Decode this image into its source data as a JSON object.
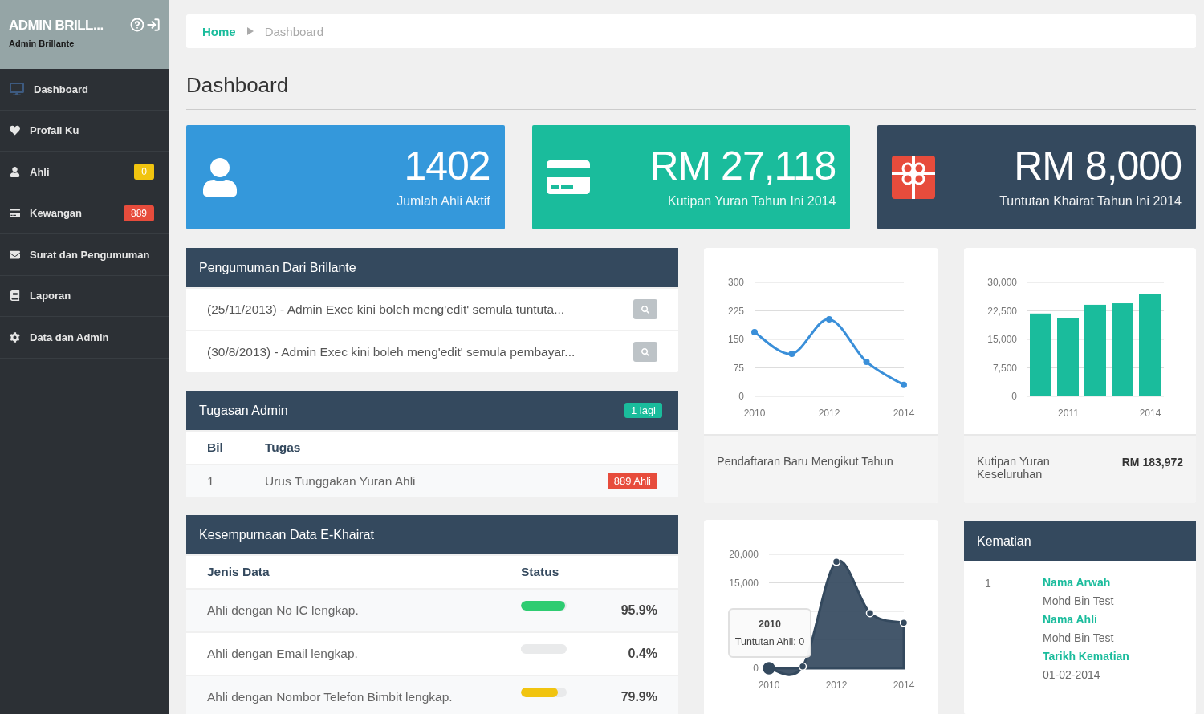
{
  "sidebar": {
    "title": "ADMIN BRILL...",
    "user": "Admin Brillante",
    "items": [
      {
        "label": "Dashboard",
        "selected": false
      },
      {
        "label": "Profail Ku",
        "selected": false
      },
      {
        "label": "Ahli",
        "selected": false,
        "badge": "0",
        "color": "#f1c40f"
      },
      {
        "label": "Kewangan",
        "selected": false,
        "badge": "889",
        "color": "#e74c3c"
      },
      {
        "label": "Surat dan Pengumuman",
        "selected": false
      },
      {
        "label": "Laporan",
        "selected": false
      },
      {
        "label": "Data dan Admin",
        "selected": false
      }
    ]
  },
  "breadcrumb": [
    {
      "label": "Home",
      "current": false
    },
    {
      "label": "Dashboard",
      "current": true
    }
  ],
  "page_title": "Dashboard",
  "stats": [
    {
      "value": "1402",
      "label": "Jumlah Ahli Aktif",
      "color": "#3498db"
    },
    {
      "value": "RM 27,118",
      "label": "Kutipan Yuran Tahun Ini 2014",
      "color": "#1abc9c"
    },
    {
      "value": "RM 8,000",
      "label": "Tuntutan Khairat Tahun Ini 2014",
      "color": "#34495e"
    }
  ],
  "announcements": {
    "title": "Pengumuman Dari Brillante",
    "items": [
      "(25/11/2013) - Admin Exec kini boleh meng'edit' semula tuntuta...",
      "(30/8/2013) - Admin Exec kini boleh meng'edit' semula pembayar..."
    ]
  },
  "tasks": {
    "title": "Tugasan Admin",
    "badge": "1 lagi",
    "columns": [
      "Bil",
      "Tugas"
    ],
    "rows": [
      {
        "no": "1",
        "task": "Urus Tunggakan Yuran Ahli",
        "badge": "889 Ahli"
      }
    ]
  },
  "completeness": {
    "title": "Kesempurnaan Data E-Khairat",
    "columns": [
      "Jenis Data",
      "Status"
    ],
    "rows": [
      {
        "label": "Ahli dengan No IC lengkap.",
        "level": 0.959,
        "value": "95.9%",
        "color": "#2ecc71"
      },
      {
        "label": "Ahli dengan Email lengkap.",
        "level": 0.004,
        "value": "0.4%"
      },
      {
        "label": "Ahli dengan Nombor Telefon Bimbit lengkap.",
        "level": 0.799,
        "value": "79.9%",
        "color": "#f1c40f"
      }
    ]
  },
  "registration_chart": {
    "caption": "Pendaftaran Baru Mengikut Tahun",
    "chart_data": {
      "type": "line",
      "x": [
        2010,
        2011,
        2012,
        2013,
        2014
      ],
      "series": [
        {
          "color": "#3a8fd9",
          "marker": "circle",
          "values": [
            169,
            112,
            203,
            91,
            30
          ]
        }
      ],
      "xlim": [
        2010,
        2014
      ],
      "grid": true,
      "ylim": [
        0,
        300
      ],
      "yticks": [
        0,
        75,
        150,
        225,
        300
      ],
      "xticks": [
        2010,
        2012,
        2014
      ]
    }
  },
  "fees_chart": {
    "caption": "Kutipan Yuran Keseluruhan",
    "total": "RM 183,972",
    "chart_data": {
      "type": "bar",
      "x": [
        2010,
        2011,
        2012,
        2013,
        2014
      ],
      "series": [
        {
          "color": "#1abc9c",
          "values": [
            21800,
            20500,
            24100,
            24500,
            27000
          ]
        }
      ],
      "xlim": [
        2009.5,
        2014.5
      ],
      "grid": true,
      "ylim": [
        0,
        30000
      ],
      "yticks": [
        {
          "value": 0,
          "label": "0"
        },
        {
          "value": 7500,
          "label": "7,500"
        },
        {
          "value": 15000,
          "label": "15,000"
        },
        {
          "value": 22500,
          "label": "22,500"
        },
        {
          "value": 30000,
          "label": "30,000"
        }
      ],
      "xticks": [
        2011,
        2014
      ]
    }
  },
  "claims_chart": {
    "tooltip": {
      "title": "2010",
      "text": "Tuntutan Ahli: 0"
    },
    "chart_data": {
      "type": "area",
      "x": [
        2010,
        2011,
        2012,
        2013,
        2014
      ],
      "series": [
        {
          "color": "#34495e",
          "marker": "circle",
          "values": [
            0,
            300,
            18700,
            9700,
            8000
          ]
        }
      ],
      "xlim": [
        2010,
        2014
      ],
      "grid": true,
      "ylim": [
        0,
        20000
      ],
      "yticks": [
        {
          "value": 0,
          "label": "0"
        },
        {
          "value": 15000,
          "label": "15,000"
        },
        {
          "value": 20000,
          "label": "20,000"
        }
      ],
      "xticks": [
        2010,
        2012,
        2014
      ]
    }
  },
  "deaths": {
    "title": "Kematian",
    "rows": [
      {
        "no": "1",
        "fields": [
          {
            "label": "Nama Arwah",
            "value": "Mohd Bin Test"
          },
          {
            "label": "Nama Ahli",
            "value": "Mohd Bin Test"
          },
          {
            "label": "Tarikh Kematian",
            "value": "01-02-2014"
          }
        ]
      }
    ]
  }
}
